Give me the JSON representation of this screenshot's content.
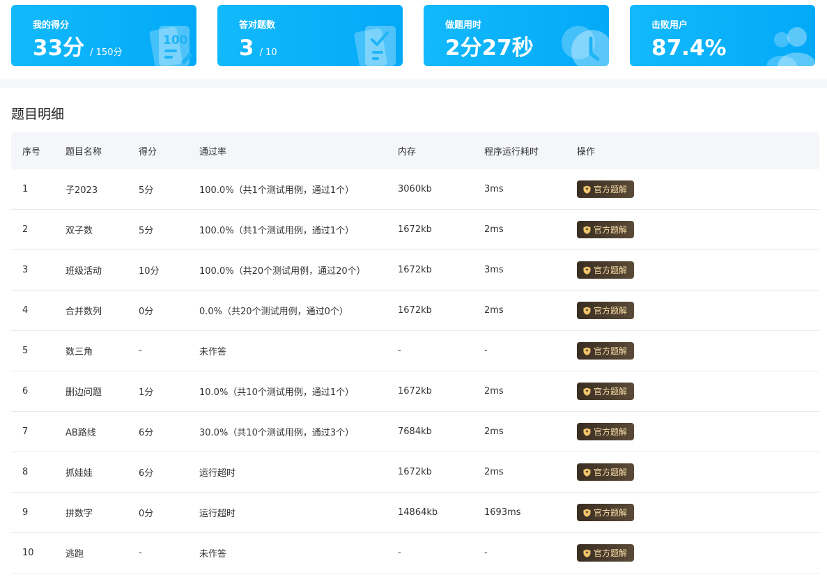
{
  "stats": [
    {
      "label": "我的得分",
      "value": "33分",
      "sub": "/ 150分",
      "icon": "score-sheet-icon"
    },
    {
      "label": "答对题数",
      "value": "3",
      "sub": "/ 10",
      "icon": "checklist-icon"
    },
    {
      "label": "做题用时",
      "value": "2分27秒",
      "sub": "",
      "icon": "clock-icon"
    },
    {
      "label": "击败用户",
      "value": "87.4%",
      "sub": "",
      "icon": "users-icon"
    }
  ],
  "section_title": "题目明细",
  "table": {
    "headers": [
      "序号",
      "题目名称",
      "得分",
      "通过率",
      "内存",
      "程序运行耗时",
      "操作"
    ],
    "button_label": "官方题解",
    "rows": [
      {
        "idx": "1",
        "name": "子2023",
        "score": "5分",
        "rate": "100.0%（共1个测试用例，通过1个）",
        "mem": "3060kb",
        "time": "3ms"
      },
      {
        "idx": "2",
        "name": "双子数",
        "score": "5分",
        "rate": "100.0%（共1个测试用例，通过1个）",
        "mem": "1672kb",
        "time": "2ms"
      },
      {
        "idx": "3",
        "name": "班级活动",
        "score": "10分",
        "rate": "100.0%（共20个测试用例，通过20个）",
        "mem": "1672kb",
        "time": "3ms"
      },
      {
        "idx": "4",
        "name": "合并数列",
        "score": "0分",
        "rate": "0.0%（共20个测试用例，通过0个）",
        "mem": "1672kb",
        "time": "2ms"
      },
      {
        "idx": "5",
        "name": "数三角",
        "score": "-",
        "rate": "未作答",
        "mem": "-",
        "time": "-"
      },
      {
        "idx": "6",
        "name": "删边问题",
        "score": "1分",
        "rate": "10.0%（共10个测试用例，通过1个）",
        "mem": "1672kb",
        "time": "2ms"
      },
      {
        "idx": "7",
        "name": "AB路线",
        "score": "6分",
        "rate": "30.0%（共10个测试用例，通过3个）",
        "mem": "7684kb",
        "time": "2ms"
      },
      {
        "idx": "8",
        "name": "抓娃娃",
        "score": "6分",
        "rate": "运行超时",
        "mem": "1672kb",
        "time": "2ms"
      },
      {
        "idx": "9",
        "name": "拼数字",
        "score": "0分",
        "rate": "运行超时",
        "mem": "14864kb",
        "time": "1693ms"
      },
      {
        "idx": "10",
        "name": "逃跑",
        "score": "-",
        "rate": "未作答",
        "mem": "-",
        "time": "-"
      }
    ]
  },
  "colors": {
    "card_blue": "#03a9f7",
    "button_dark": "#3a2e22",
    "button_text": "#f5d9a4"
  }
}
